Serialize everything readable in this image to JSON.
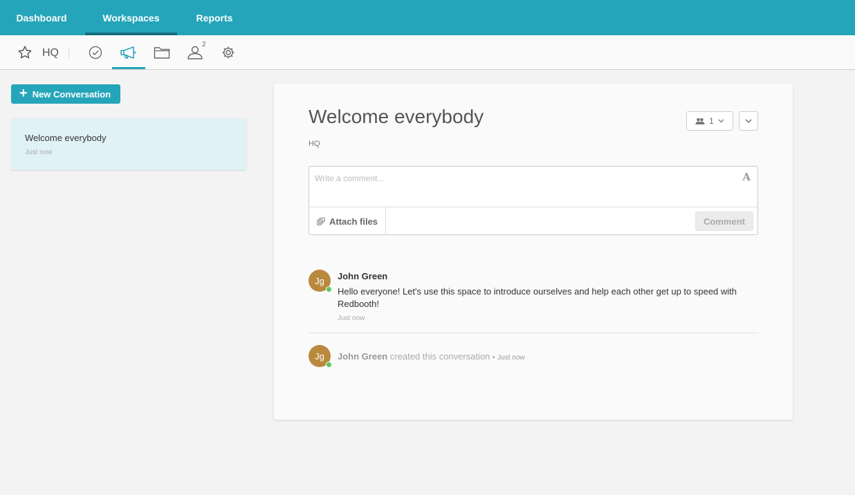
{
  "topnav": {
    "tabs": [
      {
        "label": "Dashboard"
      },
      {
        "label": "Workspaces"
      },
      {
        "label": "Reports"
      }
    ]
  },
  "workspace": {
    "name": "HQ",
    "members_badge": "2",
    "tool_icons": [
      "star-icon",
      "tasks-check-icon",
      "megaphone-icon",
      "folder-icon",
      "people-icon",
      "gear-icon"
    ]
  },
  "sidebar": {
    "new_button_label": "New Conversation",
    "conversations": [
      {
        "title": "Welcome everybody",
        "time": "Just now"
      }
    ]
  },
  "conversation": {
    "title": "Welcome everybody",
    "workspace": "HQ",
    "members_count": "1",
    "comment_placeholder": "Write a comment...",
    "attach_label": "Attach files",
    "comment_button_label": "Comment",
    "messages": [
      {
        "author_initials": "Jg",
        "author": "John Green",
        "body": "Hello everyone! Let's use this space to introduce ourselves and help each other get up to speed with Redbooth!",
        "time": "Just now"
      }
    ],
    "activity": {
      "author_initials": "Jg",
      "author": "John Green",
      "action": "created this conversation",
      "separator": "•",
      "time": "Just now"
    }
  },
  "colors": {
    "brand": "#25a5ba",
    "active_underline": "#176f80",
    "selected_card": "#e1f2f7",
    "avatar": "#b9893e",
    "online": "#5cc85c"
  }
}
